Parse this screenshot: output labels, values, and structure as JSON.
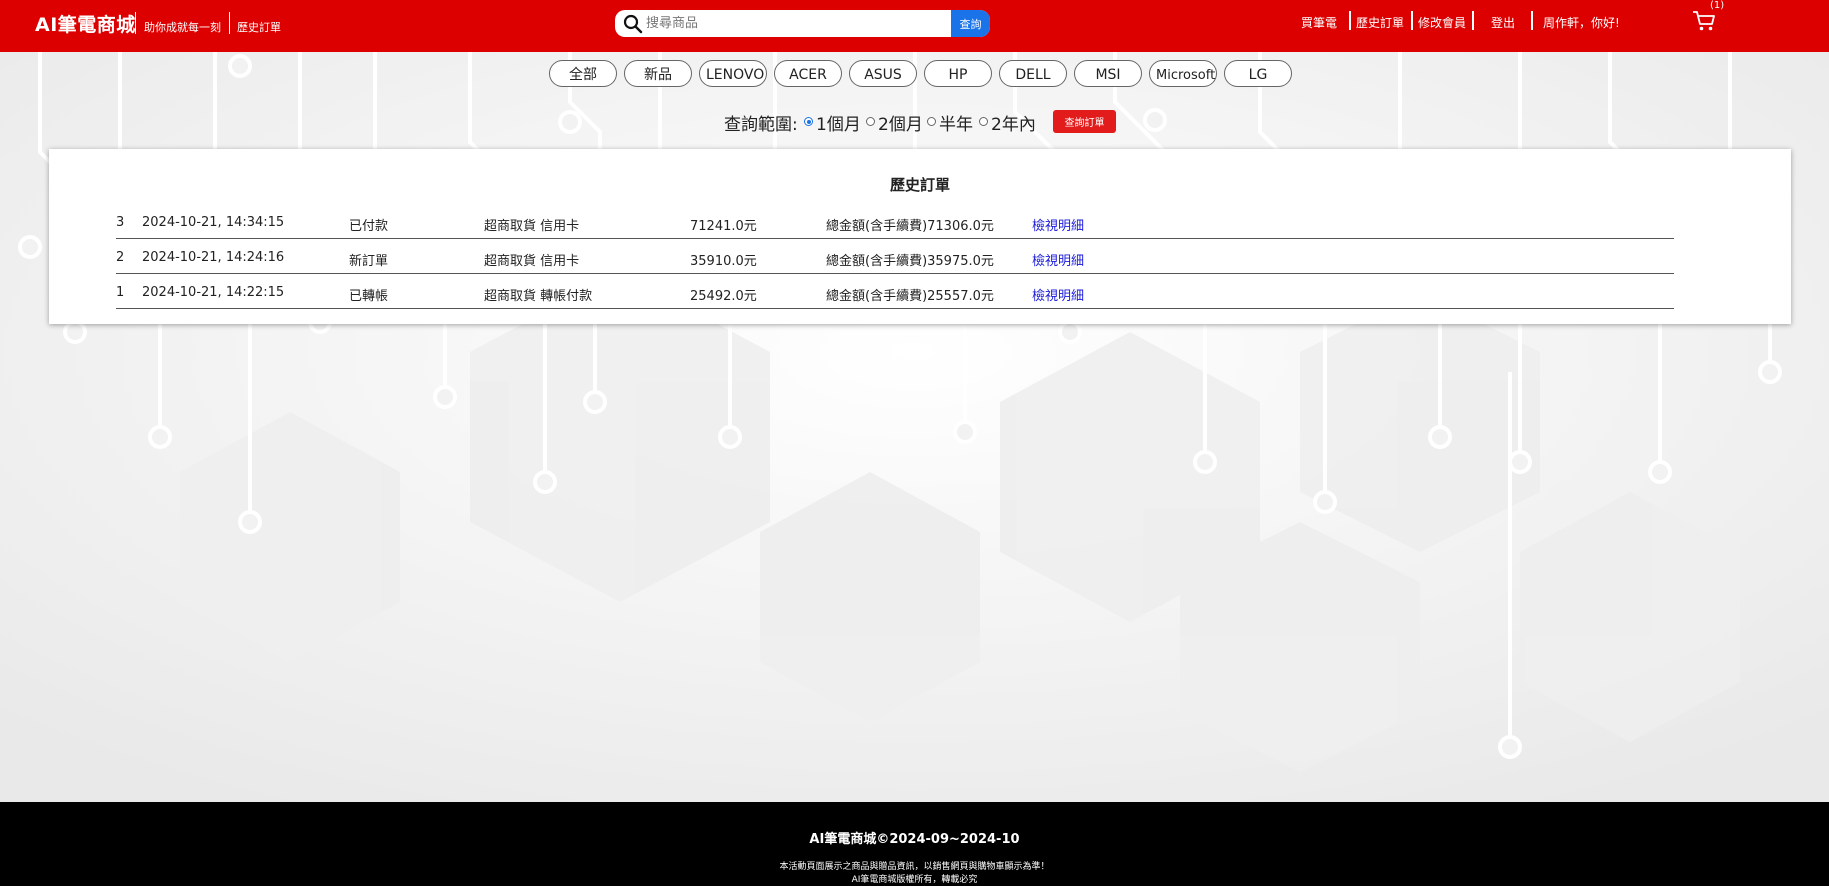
{
  "header": {
    "brand": "AI筆電商城",
    "tagline": "助你成就每一刻",
    "history_link": "歷史訂單",
    "search": {
      "placeholder": "搜尋商品",
      "button_label": "查詢"
    },
    "nav": {
      "buy": "買筆電",
      "history": "歷史訂單",
      "edit_member": "修改會員",
      "logout": "登出",
      "greeting": "周作軒，你好!"
    },
    "cart_count": "(1)"
  },
  "categories": [
    "全部",
    "新品",
    "LENOVO",
    "ACER",
    "ASUS",
    "HP",
    "DELL",
    "MSI",
    "Microsoft",
    "LG"
  ],
  "range": {
    "label": "查詢範圍:",
    "options": [
      "1個月",
      "2個月",
      "半年",
      "2年內"
    ],
    "selected": "1個月",
    "button_label": "查詢訂單"
  },
  "orders": {
    "title": "歷史訂單",
    "rows": [
      {
        "no": "3",
        "datetime": "2024-10-21, 14:34:15",
        "status": "已付款",
        "delivery": "超商取貨 信用卡",
        "amount": "71241.0元",
        "total": "總金額(含手續費)71306.0元",
        "detail": "檢視明細"
      },
      {
        "no": "2",
        "datetime": "2024-10-21, 14:24:16",
        "status": "新訂單",
        "delivery": "超商取貨 信用卡",
        "amount": "35910.0元",
        "total": "總金額(含手續費)35975.0元",
        "detail": "檢視明細"
      },
      {
        "no": "1",
        "datetime": "2024-10-21, 14:22:15",
        "status": "已轉帳",
        "delivery": "超商取貨 轉帳付款",
        "amount": "25492.0元",
        "total": "總金額(含手續費)25557.0元",
        "detail": "檢視明細"
      }
    ]
  },
  "footer": {
    "title": "AI筆電商城©2024-09~2024-10",
    "line1": "本活動頁面展示之商品與贈品資訊，以銷售網頁與購物車顯示為準！",
    "line2": "AI筆電商城版權所有，轉載必究"
  },
  "colors": {
    "header": "#dd0000",
    "search_button": "#1a73e8",
    "query_button": "#e21b1b",
    "link": "#1a1add",
    "footer": "#000000"
  }
}
